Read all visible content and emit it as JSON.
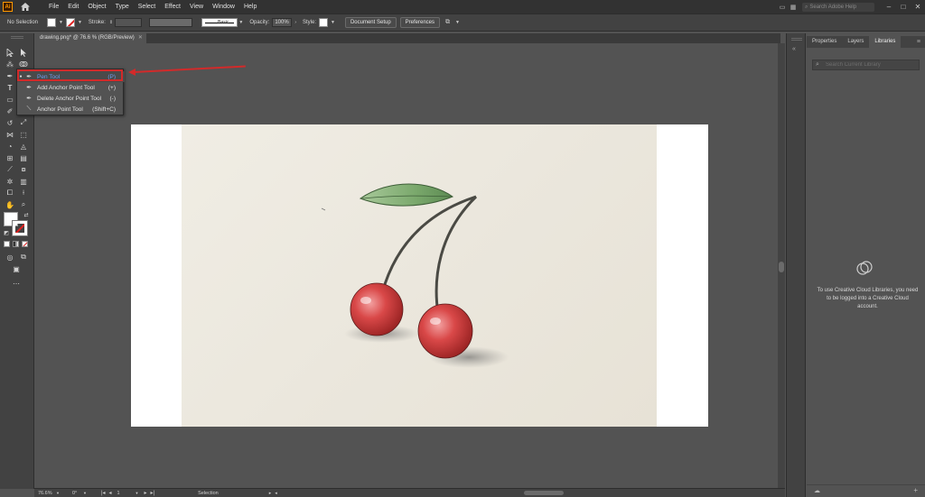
{
  "app": {
    "logo_text": "Ai",
    "menu": [
      "File",
      "Edit",
      "Object",
      "Type",
      "Select",
      "Effect",
      "View",
      "Window",
      "Help"
    ],
    "search_placeholder": "Search Adobe Help"
  },
  "control_bar": {
    "selection_label": "No Selection",
    "stroke_label": "Stroke:",
    "stroke_style": "Basic",
    "opacity_label": "Opacity:",
    "opacity_value": "100%",
    "style_label": "Style:",
    "document_setup": "Document Setup",
    "preferences": "Preferences"
  },
  "document": {
    "tab_title": "drawing.png* @ 76.6 % (RGB/Preview)"
  },
  "flyout": {
    "items": [
      {
        "label": "Pen Tool",
        "shortcut": "(P)"
      },
      {
        "label": "Add Anchor Point Tool",
        "shortcut": "(+)"
      },
      {
        "label": "Delete Anchor Point Tool",
        "shortcut": "(-)"
      },
      {
        "label": "Anchor Point Tool",
        "shortcut": "(Shift+C)"
      }
    ]
  },
  "status_bar": {
    "zoom": "76.6%",
    "rotation": "0°",
    "artboard_number": "1",
    "mode": "Selection"
  },
  "panel": {
    "tabs": [
      "Properties",
      "Layers",
      "Libraries"
    ],
    "active_tab": "Libraries",
    "search_placeholder": "Search Current Library",
    "message": "To use Creative Cloud Libraries, you need to be logged into a Creative Cloud account."
  },
  "colors": {
    "accent_blue": "#6e9ff2",
    "highlight_red": "#d22a2a",
    "ui_dark": "#323232",
    "ui_panel": "#424242",
    "canvas": "#535353"
  }
}
